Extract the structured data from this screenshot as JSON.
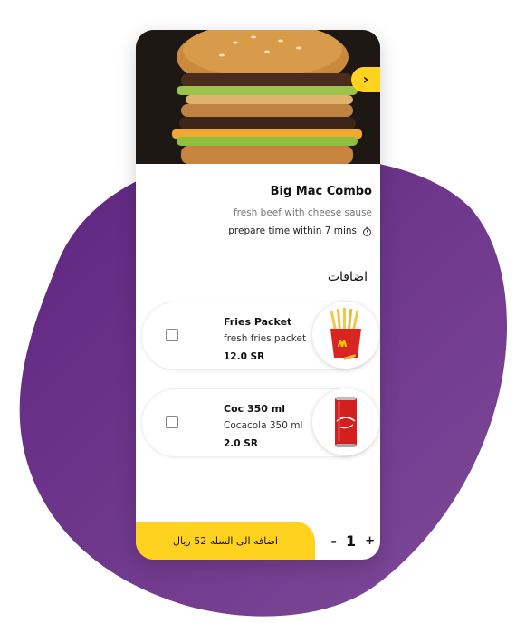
{
  "product": {
    "title": "Big Mac Combo",
    "description": "fresh beef with cheese sause",
    "prepare_time": "prepare time within 7 mins"
  },
  "addons": {
    "section_title": "اضافات",
    "items": [
      {
        "name": "Fries Packet",
        "description": "fresh fries packet",
        "price": "12.0 SR",
        "icon": "fries-icon",
        "checked": false
      },
      {
        "name": "Coc 350 ml",
        "description": "Cocacola 350 ml",
        "price": "2.0 SR",
        "icon": "cola-can-icon",
        "checked": false
      }
    ]
  },
  "footer": {
    "add_to_cart_label": "اضافه الى السله 52 ريال",
    "quantity": "1",
    "minus_label": "-",
    "plus_label": "+"
  },
  "colors": {
    "accent": "#ffd21f",
    "blob": "#6b2d8a"
  },
  "icons": {
    "next": "chevron-right-icon",
    "timer": "stopwatch-icon"
  }
}
